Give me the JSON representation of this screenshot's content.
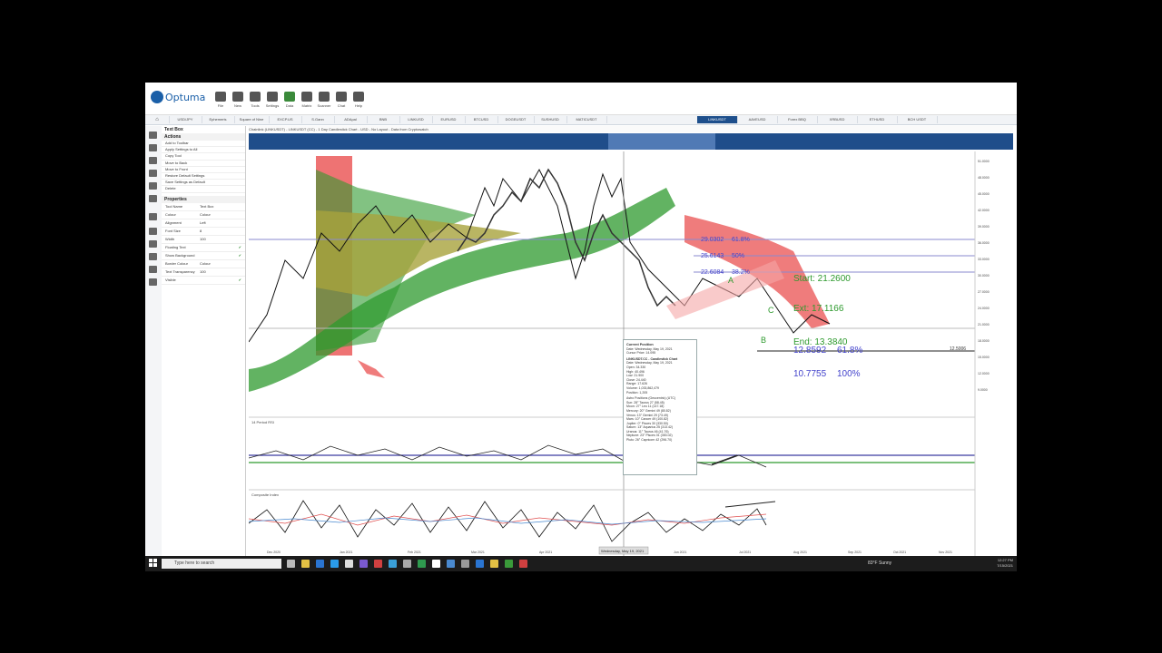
{
  "app": {
    "logo": "Optuma"
  },
  "ribbon": [
    {
      "label": "File"
    },
    {
      "label": "New"
    },
    {
      "label": "Tools"
    },
    {
      "label": "Settings"
    },
    {
      "label": "Data"
    },
    {
      "label": "Matrix"
    },
    {
      "label": "Scanner"
    },
    {
      "label": "Chat"
    },
    {
      "label": "Help"
    }
  ],
  "tabs": [
    {
      "label": "USD/JPY"
    },
    {
      "label": "Ephemeris"
    },
    {
      "label": "Square of Nine"
    },
    {
      "label": "EXCP.US"
    },
    {
      "label": "S.Gann"
    },
    {
      "label": "ADApal"
    },
    {
      "label": "BNB"
    },
    {
      "label": "LINKUSD"
    },
    {
      "label": "EURUSD"
    },
    {
      "label": "BTCUSD"
    },
    {
      "label": "DOGEUSDT"
    },
    {
      "label": "SUSHUSD"
    },
    {
      "label": "MATICUSDT"
    },
    {
      "label": "LINKUSDT",
      "active": true
    },
    {
      "label": "AAVEUSD"
    },
    {
      "label": "Forex BBQ"
    },
    {
      "label": "XRBUSD"
    },
    {
      "label": "ETHUSD"
    },
    {
      "label": "BCH USDT"
    }
  ],
  "panel": {
    "title": "Text Box",
    "actions_header": "Actions",
    "actions": [
      "Add to Toolbar",
      "Apply Settings to All",
      "Copy Tool",
      "Move to Back",
      "Move to Front",
      "Restore Default Settings",
      "Save Settings as Default",
      "Delete"
    ],
    "properties_header": "Properties",
    "properties": [
      {
        "name": "Tool Name",
        "value": "Text Box"
      },
      {
        "name": "Colour",
        "value": "Colour"
      },
      {
        "name": "Alignment",
        "value": "Left"
      },
      {
        "name": "Font Size",
        "value": "8"
      },
      {
        "name": "Width",
        "value": "100"
      },
      {
        "name": "Floating Text",
        "value": ""
      },
      {
        "name": "Show Background",
        "value": ""
      },
      {
        "name": "Border Colour",
        "value": "Colour"
      },
      {
        "name": "Text Transparency",
        "value": "100"
      },
      {
        "name": "Visible",
        "value": ""
      }
    ]
  },
  "chart": {
    "header": "Chainlink (LINKUSDT) - LINKUSDT (CC) - 1 Day Candlestick Chart - USD - No Layout - Data from Cryptowatch",
    "price_axis": [
      "51.0000",
      "48.0000",
      "45.0000",
      "42.0000",
      "39.0000",
      "36.0000",
      "33.0000",
      "30.0000",
      "27.0000",
      "24.0000",
      "21.0000",
      "18.0000",
      "15.0000",
      "12.0000",
      "9.0000"
    ],
    "fib_levels": [
      {
        "label": "29.0302",
        "pct": "61.8%"
      },
      {
        "label": "25.6143",
        "pct": "50%"
      },
      {
        "label": "22.6084",
        "pct": "38.2%"
      }
    ],
    "projections": {
      "start": "Start: 21.2600",
      "ext": "Ext: 17.1166",
      "end": "End: 13.3840",
      "p618_val": "12.8592",
      "p618_pct": "61.8%",
      "p100_val": "10.7755",
      "p100_pct": "100%"
    },
    "wave_labels": {
      "a": "A",
      "b": "B",
      "c": "C"
    },
    "right_value": "12.5006",
    "indicator1": "14 Period RSI",
    "indicator2": "Composite Index",
    "time_axis": [
      "Dec 2020",
      "Jan 2021",
      "Feb 2021",
      "Mar 2021",
      "Apr 2021",
      "May 2021",
      "Jun 2021",
      "Jul 2021",
      "Aug 2021",
      "Sep 2021",
      "Oct 2021",
      "Nov 2021"
    ],
    "cursor_date": "Wednesday, May 19, 2021"
  },
  "tooltip": {
    "title": "Current Position",
    "lines": [
      "Date: Wednesday, May 19, 2021",
      "Cursor Price: 14.095",
      "LINKUSDT.CC - Candlestick Chart",
      "Date: Wednesday, May 19, 2021",
      "Open: 34.330",
      "High: 40.496",
      "Low: 21.900",
      "Close: 24.440",
      "Range: 17.626",
      "Volume: 1,033,862,479",
      "Position: 1,205",
      "Astro Positions (Geocentric) (UTC)",
      "Sun: 28° Taurus 27 (58.45)",
      "Moon: 27° Leo 11 (147.18)",
      "Mercury: 20° Gemini 49 (80.82)",
      "Venus: 13° Gemini 29 (73.49)",
      "Mars: 10° Cancer 49 (100.82)",
      "Jupiter: 0° Pisces 30 (330.50)",
      "Saturn: 13° Aquarius 25 (313.42)",
      "Uranus: 11° Taurus 46 (41.76)",
      "Neptune: 23° Pisces 01 (353.02)",
      "Pluto: 26° Capricorn 42 (296.70)"
    ]
  },
  "taskbar": {
    "search_placeholder": "Type here to search",
    "weather": "83°F Sunny",
    "time": "12:27 PM",
    "date": "7/15/2021"
  },
  "colors": {
    "accent": "#1e4f8c",
    "bull": "#2e9a2e",
    "bear": "#e84444",
    "olive": "#a8a23c"
  }
}
